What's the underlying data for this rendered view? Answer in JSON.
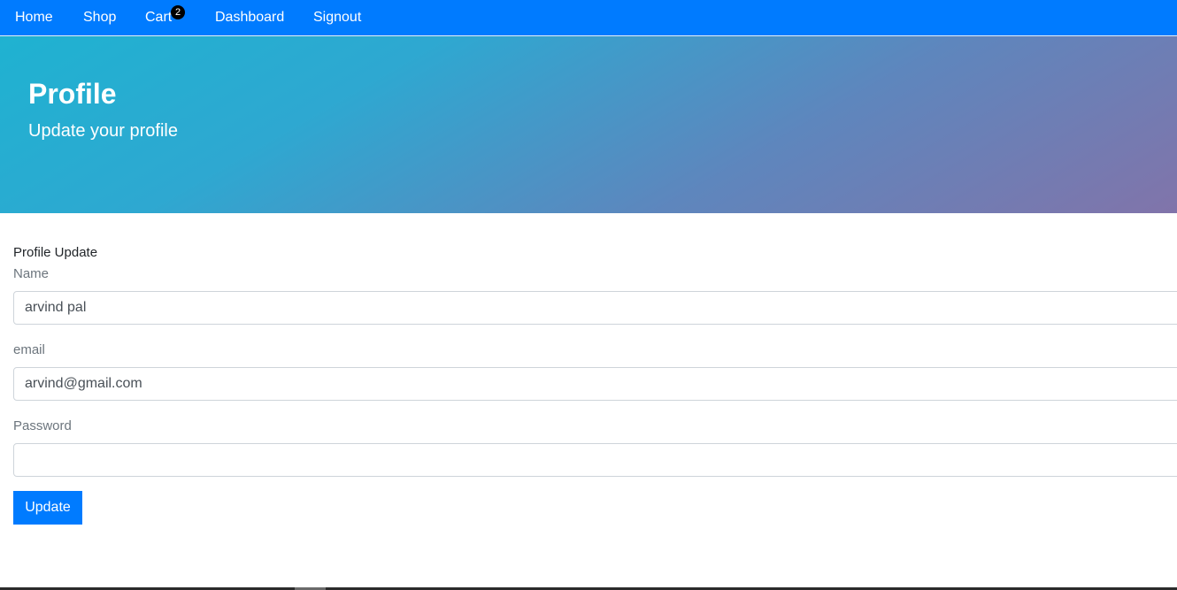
{
  "nav": {
    "home": "Home",
    "shop": "Shop",
    "cart": "Cart",
    "cart_count": "2",
    "dashboard": "Dashboard",
    "signout": "Signout"
  },
  "hero": {
    "title": "Profile",
    "subtitle": "Update your profile"
  },
  "form": {
    "heading": "Profile Update",
    "name_label": "Name",
    "name_value": "arvind pal",
    "email_label": "email",
    "email_value": "arvind@gmail.com",
    "password_label": "Password",
    "password_value": "",
    "update_label": "Update"
  },
  "colors": {
    "navbar": "#007bff",
    "button": "#007bff",
    "hero_start": "#1fb2d1",
    "hero_end": "#8174aa"
  }
}
